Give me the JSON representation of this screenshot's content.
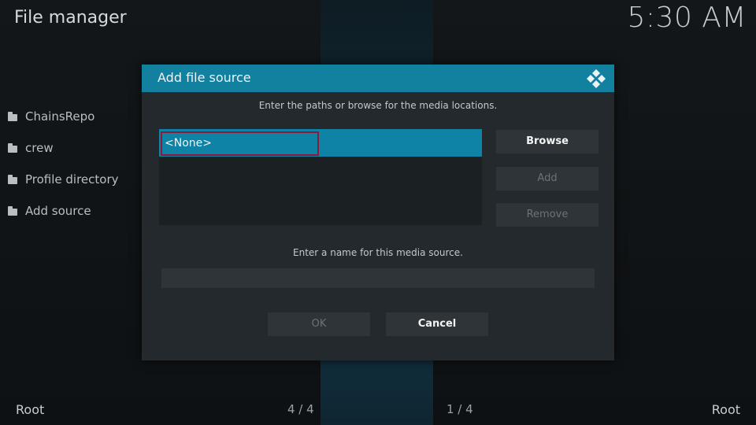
{
  "header": {
    "title": "File manager",
    "clock": "5:30 AM"
  },
  "sidebar": {
    "items": [
      {
        "label": "ChainsRepo",
        "icon": "folder-icon"
      },
      {
        "label": "crew",
        "icon": "folder-icon"
      },
      {
        "label": "Profile directory",
        "icon": "folder-icon"
      },
      {
        "label": "Add source",
        "icon": "folder-icon"
      }
    ]
  },
  "dialog": {
    "title": "Add file source",
    "logo_icon": "kodi-logo-icon",
    "paths_instruction": "Enter the paths or browse for the media locations.",
    "path_value": "<None>",
    "browse_label": "Browse",
    "add_label": "Add",
    "remove_label": "Remove",
    "name_instruction": "Enter a name for this media source.",
    "name_value": "",
    "ok_label": "OK",
    "cancel_label": "Cancel"
  },
  "footer": {
    "left": "Root",
    "page_left": "4 / 4",
    "page_right": "1 / 4",
    "right": "Root"
  },
  "colors": {
    "accent": "#12809f",
    "highlight_row": "#0e83a6",
    "focus_border": "#8b1a3a",
    "dialog_bg": "#23292d"
  }
}
